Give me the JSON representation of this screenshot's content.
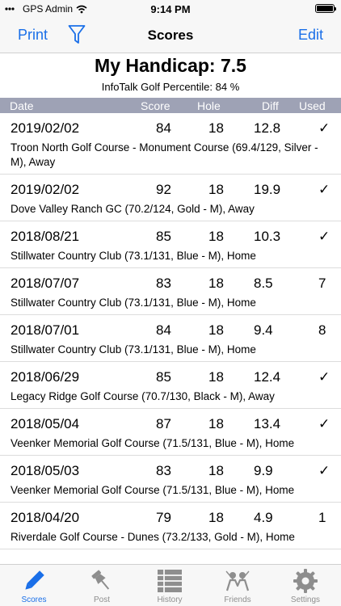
{
  "status_bar": {
    "carrier": "GPS Admin",
    "time": "9:14 PM"
  },
  "nav": {
    "left_button": "Print",
    "title": "Scores",
    "right_button": "Edit",
    "filter_icon": "filter-icon"
  },
  "summary": {
    "handicap": "My Handicap: 7.5",
    "percentile": "InfoTalk Golf Percentile: 84 %"
  },
  "columns": {
    "date": "Date",
    "score": "Score",
    "hole": "Hole",
    "diff": "Diff",
    "used": "Used"
  },
  "rows": [
    {
      "date": "2019/02/02",
      "score": "84",
      "hole": "18",
      "diff": "12.8",
      "used": "✓",
      "course": "Troon North Golf Course - Monument Course (69.4/129, Silver - M), Away"
    },
    {
      "date": "2019/02/02",
      "score": "92",
      "hole": "18",
      "diff": "19.9",
      "used": "✓",
      "course": "Dove Valley Ranch GC (70.2/124, Gold - M), Away"
    },
    {
      "date": "2018/08/21",
      "score": "85",
      "hole": "18",
      "diff": "10.3",
      "used": "✓",
      "course": "Stillwater Country Club (73.1/131, Blue - M), Home"
    },
    {
      "date": "2018/07/07",
      "score": "83",
      "hole": "18",
      "diff": "8.5",
      "used": "7",
      "course": "Stillwater Country Club (73.1/131, Blue - M), Home"
    },
    {
      "date": "2018/07/01",
      "score": "84",
      "hole": "18",
      "diff": "9.4",
      "used": "8",
      "course": "Stillwater Country Club (73.1/131, Blue - M), Home"
    },
    {
      "date": "2018/06/29",
      "score": "85",
      "hole": "18",
      "diff": "12.4",
      "used": "✓",
      "course": "Legacy Ridge Golf Course (70.7/130, Black - M), Away"
    },
    {
      "date": "2018/05/04",
      "score": "87",
      "hole": "18",
      "diff": "13.4",
      "used": "✓",
      "course": "Veenker Memorial Golf Course (71.5/131, Blue - M), Home"
    },
    {
      "date": "2018/05/03",
      "score": "83",
      "hole": "18",
      "diff": "9.9",
      "used": "✓",
      "course": "Veenker Memorial Golf Course (71.5/131, Blue - M), Home"
    },
    {
      "date": "2018/04/20",
      "score": "79",
      "hole": "18",
      "diff": "4.9",
      "used": "1",
      "course": "Riverdale Golf Course - Dunes (73.2/133, Gold - M), Home"
    }
  ],
  "tabs": [
    {
      "label": "Scores",
      "icon": "pencil-icon",
      "active": true
    },
    {
      "label": "Post",
      "icon": "pin-icon",
      "active": false
    },
    {
      "label": "History",
      "icon": "list-icon",
      "active": false
    },
    {
      "label": "Friends",
      "icon": "people-icon",
      "active": false
    },
    {
      "label": "Settings",
      "icon": "gear-icon",
      "active": false
    }
  ],
  "colors": {
    "accent": "#1a6fe8",
    "header_bg": "#9ea2b5",
    "tab_inactive": "#8e8e8e"
  }
}
